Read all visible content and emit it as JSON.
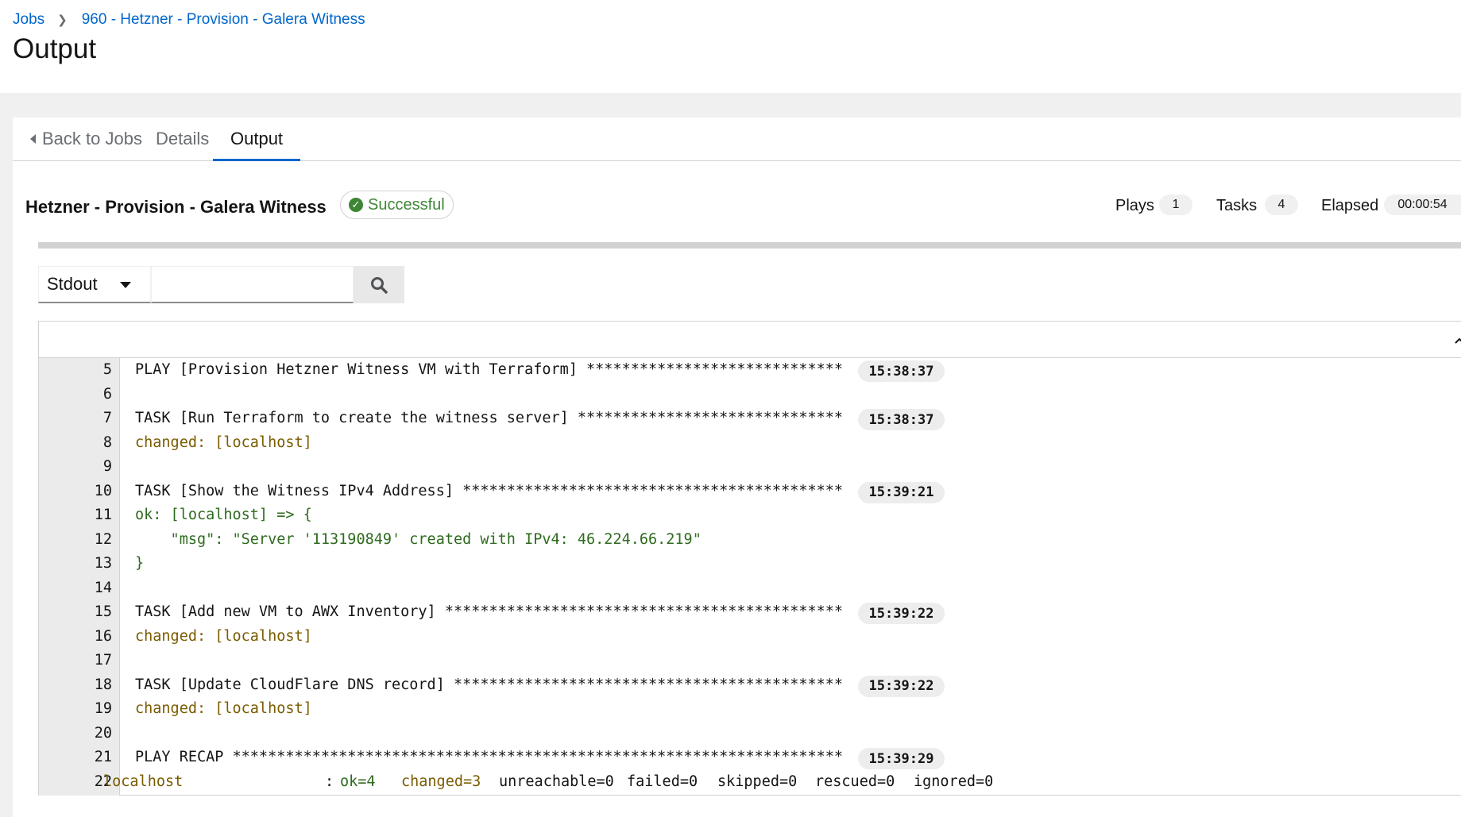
{
  "breadcrumb": {
    "jobs": "Jobs",
    "current": "960 - Hetzner - Provision - Galera Witness"
  },
  "page_title": "Output",
  "tabs": {
    "back": "Back to Jobs",
    "details": "Details",
    "output": "Output"
  },
  "job": {
    "name": "Hetzner - Provision - Galera Witness",
    "status": "Successful",
    "plays_label": "Plays",
    "plays": "1",
    "tasks_label": "Tasks",
    "tasks": "4",
    "elapsed_label": "Elapsed",
    "elapsed": "00:00:54"
  },
  "toolbar": {
    "stdout_label": "Stdout",
    "search_placeholder": ""
  },
  "output": {
    "lines": [
      {
        "n": "5",
        "text": "PLAY [Provision Hetzner Witness VM with Terraform] *****************************",
        "cls": "",
        "ts": "15:38:37"
      },
      {
        "n": "6",
        "text": "",
        "cls": "",
        "ts": ""
      },
      {
        "n": "7",
        "text": "TASK [Run Terraform to create the witness server] ******************************",
        "cls": "",
        "ts": "15:38:37"
      },
      {
        "n": "8",
        "text": "changed: [localhost]",
        "cls": "c-changed",
        "ts": ""
      },
      {
        "n": "9",
        "text": "",
        "cls": "",
        "ts": ""
      },
      {
        "n": "10",
        "text": "TASK [Show the Witness IPv4 Address] *******************************************",
        "cls": "",
        "ts": "15:39:21"
      },
      {
        "n": "11",
        "text": "ok: [localhost] => {",
        "cls": "c-ok",
        "ts": ""
      },
      {
        "n": "12",
        "text": "    \"msg\": \"Server '113190849' created with IPv4: 46.224.66.219\"",
        "cls": "c-ok",
        "ts": ""
      },
      {
        "n": "13",
        "text": "}",
        "cls": "c-ok",
        "ts": ""
      },
      {
        "n": "14",
        "text": "",
        "cls": "",
        "ts": ""
      },
      {
        "n": "15",
        "text": "TASK [Add new VM to AWX Inventory] *********************************************",
        "cls": "",
        "ts": "15:39:22"
      },
      {
        "n": "16",
        "text": "changed: [localhost]",
        "cls": "c-changed",
        "ts": ""
      },
      {
        "n": "17",
        "text": "",
        "cls": "",
        "ts": ""
      },
      {
        "n": "18",
        "text": "TASK [Update CloudFlare DNS record] ********************************************",
        "cls": "",
        "ts": "15:39:22"
      },
      {
        "n": "19",
        "text": "changed: [localhost]",
        "cls": "c-changed",
        "ts": ""
      },
      {
        "n": "20",
        "text": "",
        "cls": "",
        "ts": ""
      },
      {
        "n": "21",
        "text": "PLAY RECAP *********************************************************************",
        "cls": "",
        "ts": "15:39:29"
      },
      {
        "n": "22",
        "text": "",
        "cls": "recap",
        "ts": ""
      }
    ],
    "recap": {
      "host": "localhost",
      "ok": "ok=4",
      "changed": "changed=3",
      "unreachable": "unreachable=0",
      "failed": "failed=0",
      "skipped": "skipped=0",
      "rescued": "rescued=0",
      "ignored": "ignored=0"
    }
  },
  "colors": {
    "link": "#0066cc",
    "success": "#3e8635",
    "changed": "#7a5c00",
    "ok": "#2e6b1e"
  }
}
